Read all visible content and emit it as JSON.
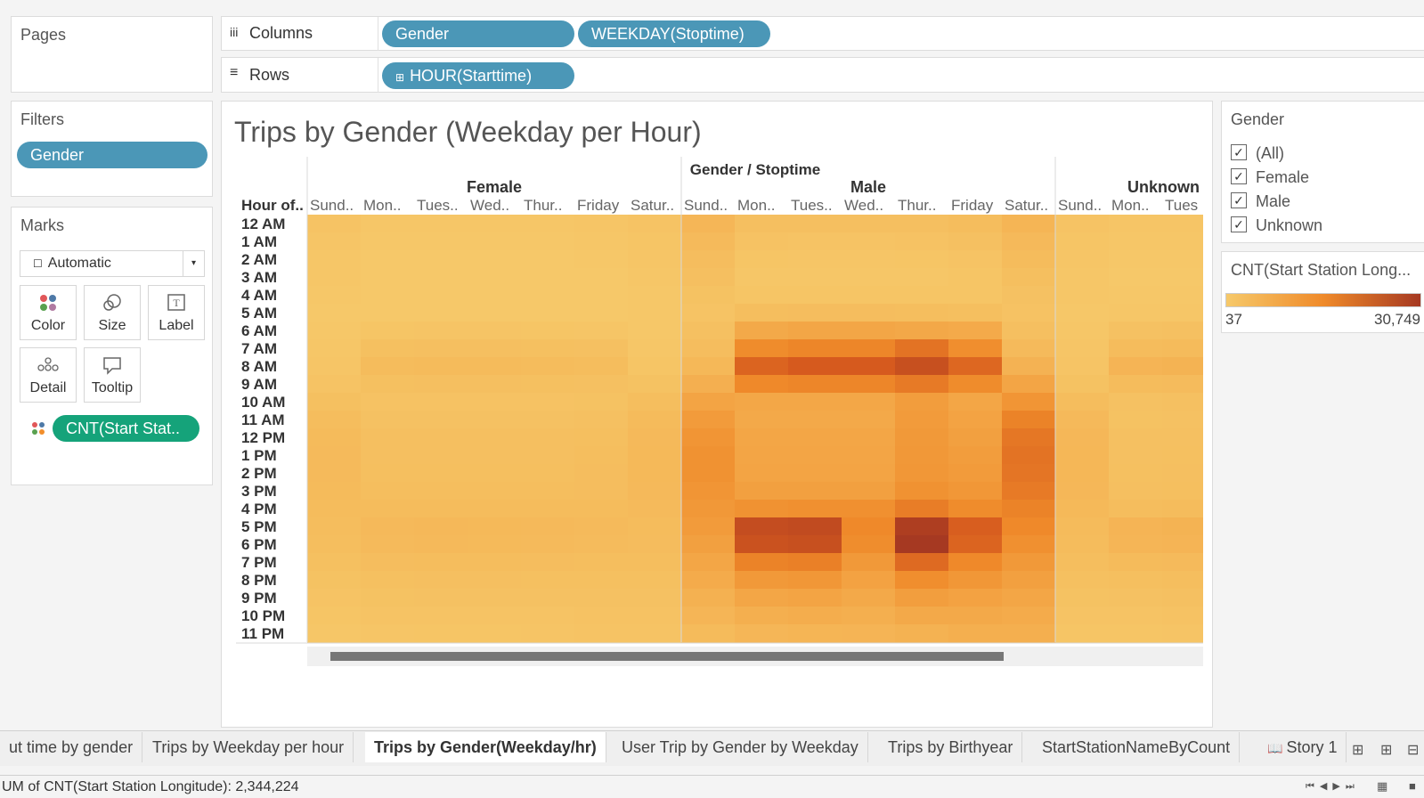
{
  "shelves": {
    "pages_title": "Pages",
    "columns_label": "Columns",
    "rows_label": "Rows",
    "columns_pills": [
      "Gender",
      "WEEKDAY(Stoptime)"
    ],
    "rows_pill": "HOUR(Starttime)"
  },
  "filters": {
    "title": "Filters",
    "pill": "Gender"
  },
  "marks": {
    "title": "Marks",
    "type": "Automatic",
    "buttons": [
      "Color",
      "Size",
      "Label",
      "Detail",
      "Tooltip"
    ],
    "field_pill": "CNT(Start Stat.."
  },
  "viz": {
    "title": "Trips by Gender (Weekday per Hour)",
    "top_header": "Gender / Stoptime",
    "row_header": "Hour of..",
    "groups": [
      "Female",
      "Male",
      "Unknown"
    ]
  },
  "legend_gender": {
    "title": "Gender",
    "items": [
      "(All)",
      "Female",
      "Male",
      "Unknown"
    ]
  },
  "legend_color": {
    "title": "CNT(Start Station Long...",
    "min_label": "37",
    "max_label": "30,749",
    "colors": [
      "#f6c96a",
      "#ef8a2a",
      "#a63922"
    ]
  },
  "tabs": [
    "ut time by gender",
    "Trips by Weekday per hour",
    "Trips by Gender(Weekday/hr)",
    "User Trip by Gender by Weekday",
    "Trips by Birthyear",
    "StartStationNameByCount",
    "Story 1"
  ],
  "active_tab": "Trips by Gender(Weekday/hr)",
  "status": "UM of CNT(Start Station Longitude): 2,344,224",
  "chart_data": {
    "type": "heatmap",
    "title": "Trips by Gender (Weekday per Hour)",
    "column_header": "Gender / Stoptime",
    "row_label": "Hour of..",
    "rows": [
      "12 AM",
      "1 AM",
      "2 AM",
      "3 AM",
      "4 AM",
      "5 AM",
      "6 AM",
      "7 AM",
      "8 AM",
      "9 AM",
      "10 AM",
      "11 AM",
      "12 PM",
      "1 PM",
      "2 PM",
      "3 PM",
      "4 PM",
      "5 PM",
      "6 PM",
      "7 PM",
      "8 PM",
      "9 PM",
      "10 PM",
      "11 PM"
    ],
    "day_labels": [
      "Sund..",
      "Mon..",
      "Tues..",
      "Wed..",
      "Thur..",
      "Friday",
      "Satur.."
    ],
    "unknown_day_labels": [
      "Sund..",
      "Mon..",
      "Tues"
    ],
    "color_range": [
      37,
      30749
    ],
    "series": [
      {
        "name": "Female",
        "values": [
          [
            1500,
            900,
            900,
            900,
            900,
            1000,
            1500
          ],
          [
            1100,
            600,
            500,
            600,
            600,
            700,
            1200
          ],
          [
            900,
            400,
            400,
            400,
            400,
            500,
            1000
          ],
          [
            700,
            300,
            300,
            300,
            300,
            400,
            800
          ],
          [
            500,
            300,
            300,
            300,
            300,
            300,
            600
          ],
          [
            400,
            400,
            400,
            400,
            400,
            400,
            500
          ],
          [
            500,
            1200,
            1300,
            1300,
            1200,
            1100,
            600
          ],
          [
            700,
            2500,
            2700,
            2700,
            2500,
            2300,
            900
          ],
          [
            1000,
            3500,
            3800,
            3800,
            3500,
            3300,
            1200
          ],
          [
            1500,
            2500,
            2600,
            2600,
            2500,
            2400,
            2000
          ],
          [
            2500,
            1900,
            1900,
            1900,
            1900,
            2000,
            3000
          ],
          [
            3300,
            2200,
            2200,
            2200,
            2200,
            2400,
            3800
          ],
          [
            3800,
            2600,
            2600,
            2600,
            2600,
            2800,
            4200
          ],
          [
            4000,
            2700,
            2700,
            2700,
            2700,
            3000,
            4400
          ],
          [
            4000,
            2800,
            2800,
            2800,
            2800,
            3100,
            4400
          ],
          [
            3800,
            3000,
            3000,
            3000,
            3000,
            3200,
            4200
          ],
          [
            3600,
            3500,
            3600,
            3600,
            3500,
            3500,
            3900
          ],
          [
            3300,
            4200,
            4500,
            4400,
            4200,
            3900,
            3600
          ],
          [
            3000,
            4000,
            4200,
            4100,
            4000,
            3700,
            3400
          ],
          [
            2500,
            3200,
            3300,
            3300,
            3200,
            3000,
            3000
          ],
          [
            2000,
            2500,
            2600,
            2600,
            2500,
            2500,
            2500
          ],
          [
            1500,
            2000,
            2100,
            2100,
            2100,
            2100,
            2100
          ],
          [
            1200,
            1600,
            1700,
            1700,
            1700,
            1800,
            1800
          ],
          [
            900,
            1100,
            1200,
            1200,
            1300,
            1500,
            1600
          ]
        ]
      },
      {
        "name": "Male",
        "values": [
          [
            5000,
            2600,
            2600,
            2600,
            2700,
            3300,
            5300
          ],
          [
            4000,
            1800,
            1700,
            1700,
            1800,
            2300,
            4200
          ],
          [
            3200,
            1200,
            1100,
            1100,
            1200,
            1600,
            3500
          ],
          [
            2600,
            900,
            800,
            800,
            900,
            1200,
            2800
          ],
          [
            2000,
            1200,
            1200,
            1200,
            1200,
            1200,
            2100
          ],
          [
            1600,
            3000,
            3100,
            3100,
            3000,
            2800,
            1800
          ],
          [
            2300,
            8500,
            9000,
            9000,
            8700,
            8100,
            2700
          ],
          [
            3200,
            15000,
            16000,
            16000,
            19000,
            14500,
            4000
          ],
          [
            4600,
            21500,
            23000,
            23000,
            25500,
            21000,
            6000
          ],
          [
            6800,
            15500,
            16000,
            16000,
            18000,
            15000,
            9300
          ],
          [
            9500,
            8800,
            8800,
            8800,
            11000,
            9000,
            13000
          ],
          [
            11500,
            8500,
            8500,
            8500,
            11500,
            9800,
            16500
          ],
          [
            13000,
            9000,
            9000,
            9000,
            12000,
            10500,
            18500
          ],
          [
            13500,
            9200,
            9200,
            9200,
            12200,
            11000,
            19000
          ],
          [
            13500,
            9500,
            9500,
            9500,
            12500,
            11500,
            18800
          ],
          [
            13000,
            10500,
            10500,
            10500,
            13500,
            12500,
            18000
          ],
          [
            12300,
            13500,
            14000,
            14000,
            17500,
            15000,
            16500
          ],
          [
            11500,
            26000,
            26500,
            15500,
            29500,
            22500,
            15500
          ],
          [
            10500,
            25000,
            25500,
            14800,
            30749,
            21500,
            14000
          ],
          [
            9000,
            16500,
            17000,
            12000,
            20500,
            15500,
            12000
          ],
          [
            8000,
            12000,
            12500,
            10000,
            14500,
            12500,
            10500
          ],
          [
            6500,
            9000,
            9500,
            8500,
            10800,
            10000,
            9000
          ],
          [
            5200,
            7000,
            7500,
            7000,
            8500,
            8500,
            8000
          ],
          [
            3800,
            5000,
            5300,
            5500,
            6200,
            7000,
            7000
          ]
        ]
      },
      {
        "name": "Unknown",
        "values": [
          [
            1500,
            1000,
            1000
          ],
          [
            1200,
            700,
            700
          ],
          [
            1000,
            500,
            500
          ],
          [
            900,
            400,
            400
          ],
          [
            700,
            500,
            500
          ],
          [
            600,
            900,
            900
          ],
          [
            800,
            2200,
            2300
          ],
          [
            1000,
            3600,
            3800
          ],
          [
            1400,
            5500,
            5800
          ],
          [
            2000,
            3500,
            3700
          ],
          [
            3300,
            2200,
            2300
          ],
          [
            4200,
            2000,
            2100
          ],
          [
            4700,
            2300,
            2400
          ],
          [
            4900,
            2400,
            2500
          ],
          [
            4900,
            2500,
            2600
          ],
          [
            4700,
            2700,
            2800
          ],
          [
            4300,
            3300,
            3500
          ],
          [
            3800,
            5500,
            5800
          ],
          [
            3500,
            5200,
            5500
          ],
          [
            3000,
            3800,
            4000
          ],
          [
            2500,
            2800,
            3000
          ],
          [
            2000,
            2100,
            2300
          ],
          [
            1600,
            1600,
            1800
          ],
          [
            1200,
            1200,
            1300
          ]
        ]
      }
    ]
  }
}
